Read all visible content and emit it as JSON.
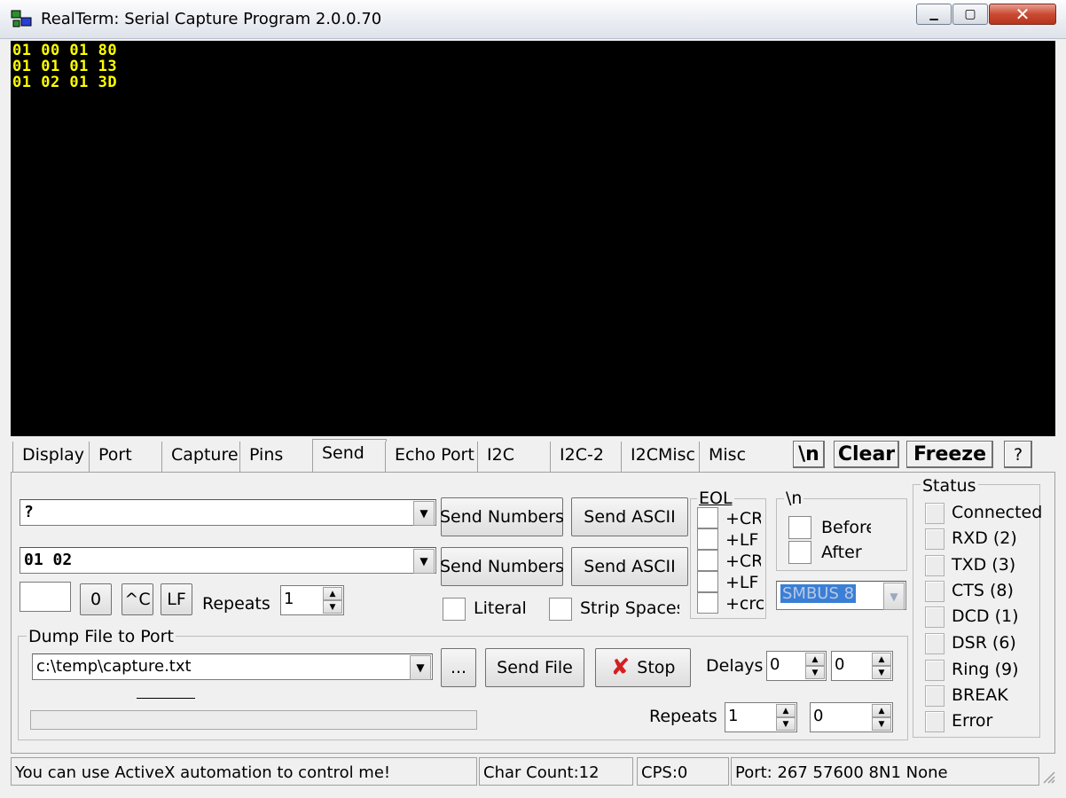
{
  "window": {
    "title": "RealTerm: Serial Capture Program 2.0.0.70",
    "min": "▁",
    "max": "▢",
    "close": "✕"
  },
  "terminal": {
    "lines": [
      "01 00 01 80",
      "01 01 01 13",
      "01 02 01 3D"
    ],
    "text_color": "#ffff00",
    "bg_color": "#000000"
  },
  "tabs": [
    {
      "label": "Display"
    },
    {
      "label": "Port"
    },
    {
      "label": "Capture"
    },
    {
      "label": "Pins"
    },
    {
      "label": "Send",
      "active": true
    },
    {
      "label": "Echo Port"
    },
    {
      "label": "I2C"
    },
    {
      "label": "I2C-2"
    },
    {
      "label": "I2CMisc"
    },
    {
      "label": "Misc"
    }
  ],
  "toolbar": {
    "newline": "\\n",
    "clear": "Clear",
    "freeze": "Freeze",
    "help": "?"
  },
  "send": {
    "line1_value": "?",
    "line2_value": "01 02",
    "send_numbers_label": "Send Numbers",
    "send_ascii_label": "Send ASCII",
    "zero_label": "0",
    "ctrl_c_label": "^C",
    "lf_label": "LF",
    "repeats_label": "Repeats",
    "repeats_value": "1",
    "literal_label": "Literal",
    "strip_spaces_label": "Strip Spaces"
  },
  "eol": {
    "title": "EOL",
    "items": [
      "+CR",
      "+LF",
      "+CR",
      "+LF",
      "+crc"
    ]
  },
  "newline_group": {
    "title": "\\n",
    "before": "Before",
    "after": "After"
  },
  "crc_select": {
    "value": "SMBUS 8"
  },
  "dump": {
    "title": "Dump File to Port",
    "file_value": "c:\\temp\\capture.txt",
    "browse_label": "...",
    "send_file_label": "Send File",
    "stop_label": "Stop",
    "delays_label": "Delays",
    "delay1_value": "0",
    "delay2_value": "0",
    "repeats_label": "Repeats",
    "repeats1_value": "1",
    "repeats2_value": "0"
  },
  "status": {
    "title": "Status",
    "items": [
      "Connected",
      "RXD (2)",
      "TXD (3)",
      "CTS (8)",
      "DCD (1)",
      "DSR (6)",
      "Ring (9)",
      "BREAK",
      "Error"
    ]
  },
  "statusbar": {
    "message": "You can use ActiveX automation to control me!",
    "char_count": "Char Count:12",
    "cps": "CPS:0",
    "port": "Port: 267 57600 8N1 None"
  }
}
